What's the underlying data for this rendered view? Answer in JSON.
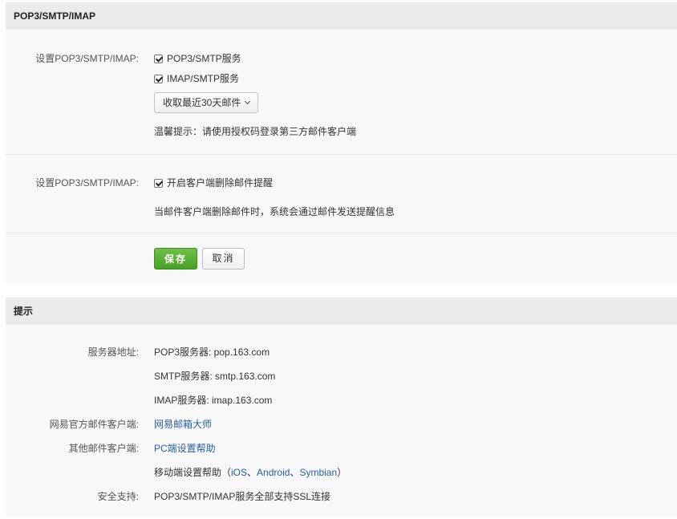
{
  "settings": {
    "title": "POP3/SMTP/IMAP",
    "section1": {
      "label": "设置POP3/SMTP/IMAP:",
      "opt_pop3": "POP3/SMTP服务",
      "opt_imap": "IMAP/SMTP服务",
      "dropdown": "收取最近30天邮件",
      "tip": "温馨提示：请使用授权码登录第三方邮件客户端"
    },
    "section2": {
      "label": "设置POP3/SMTP/IMAP:",
      "opt_delete": "开启客户端删除邮件提醒",
      "desc": "当邮件客户端删除邮件时，系统会通过邮件发送提醒信息"
    },
    "save": "保存",
    "cancel": "取消"
  },
  "hints": {
    "title": "提示",
    "server_label": "服务器地址:",
    "pop3": "POP3服务器: pop.163.com",
    "smtp": "SMTP服务器: smtp.163.com",
    "imap": "IMAP服务器: imap.163.com",
    "official_label": "网易官方邮件客户端:",
    "official_link": "网易邮箱大师",
    "other_label": "其他邮件客户端:",
    "pc_link": "PC端设置帮助",
    "mobile_prefix": "移动端设置帮助（",
    "ios_link": "iOS",
    "sep1": "、",
    "android_link": "Android",
    "sep2": "、",
    "symbian_link": "Symbian",
    "mobile_suffix": "）",
    "security_label": "安全支持:",
    "security_text": "POP3/SMTP/IMAP服务全部支持SSL连接"
  }
}
